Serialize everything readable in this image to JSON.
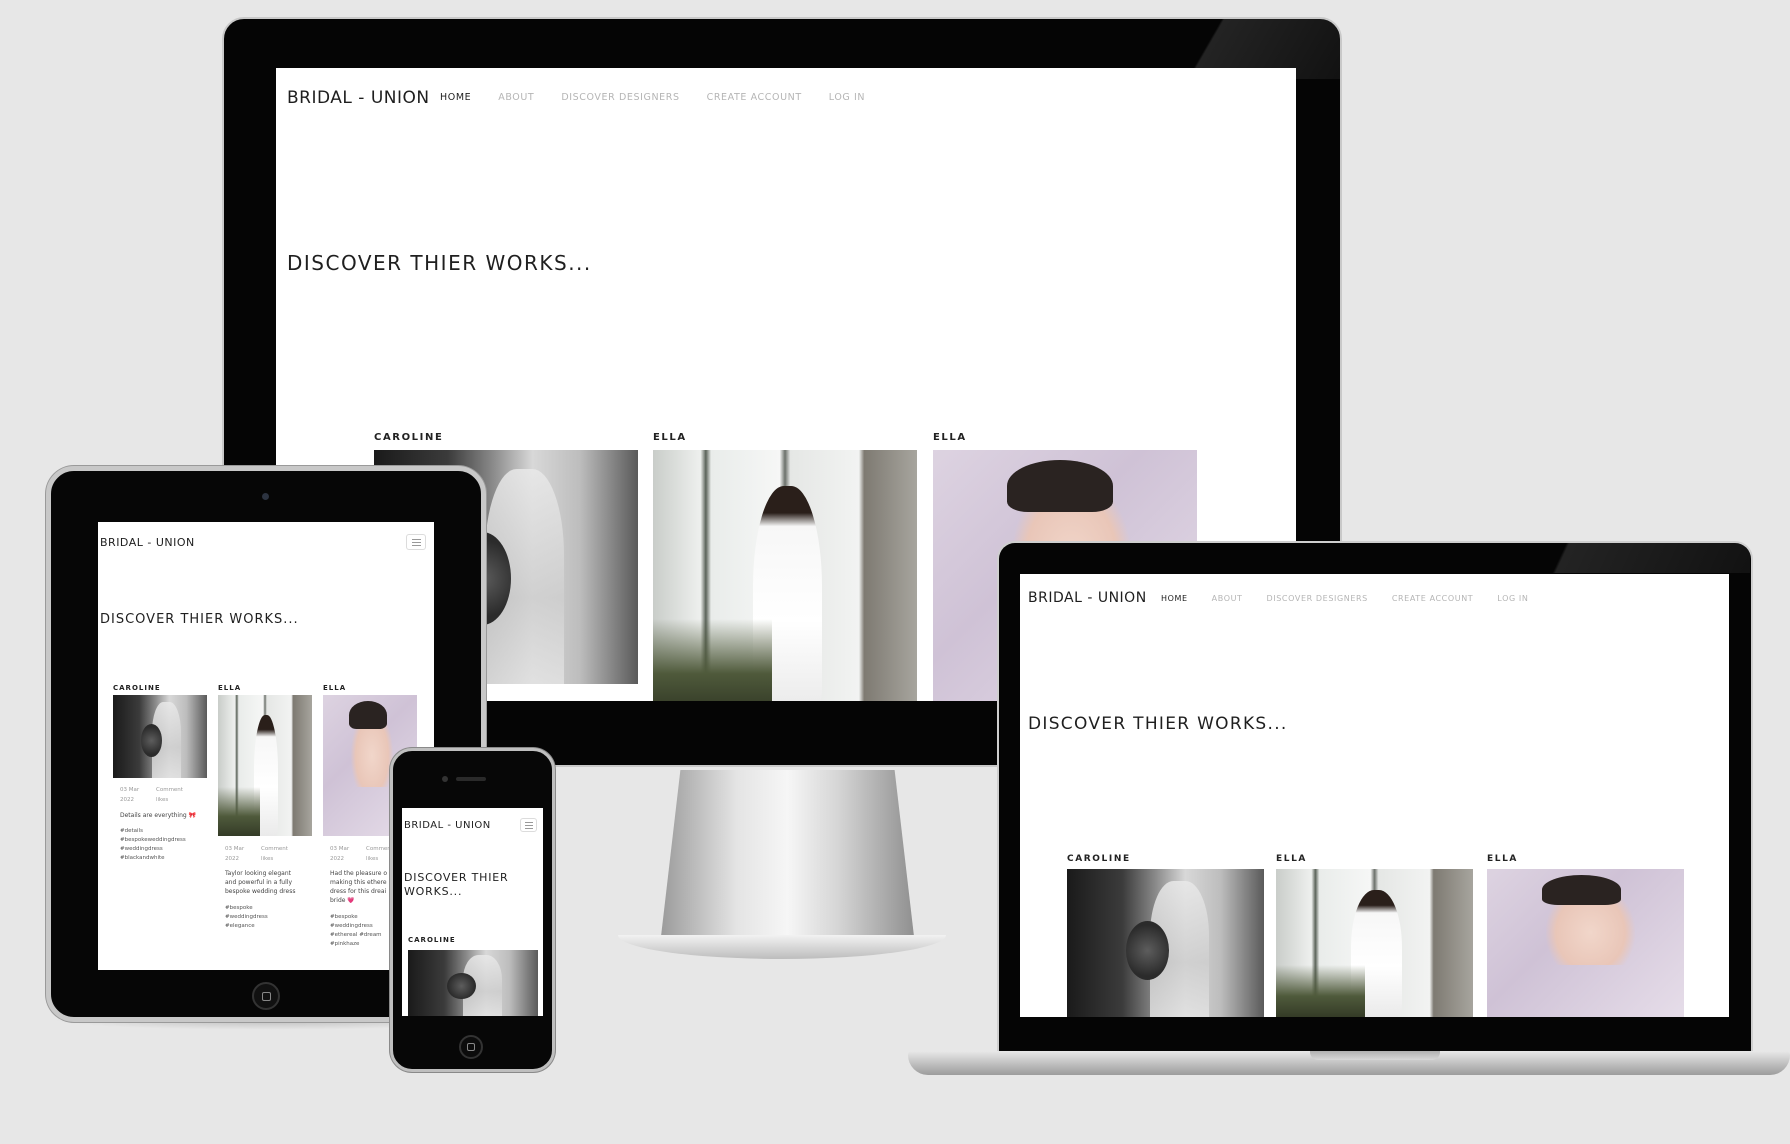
{
  "site": {
    "brand": "BRIDAL - UNION",
    "nav": [
      "HOME",
      "ABOUT",
      "DISCOVER DESIGNERS",
      "CREATE ACCOUNT",
      "LOG IN"
    ],
    "heading": "DISCOVER THIER WORKS...",
    "heading_phone_line1": "DISCOVER THIER",
    "heading_phone_line2": "WORKS...",
    "designers": [
      "CAROLINE",
      "ELLA",
      "ELLA"
    ]
  },
  "posts": [
    {
      "date": "03 Mar\n2022",
      "stats": "Comment\nlikes",
      "caption": "Details are everything 🎀",
      "tags": "#details\n#bespokeweddingdress\n#weddingdress\n#blackandwhite"
    },
    {
      "date": "03 Mar\n2022",
      "stats": "Comment\nlikes",
      "caption": "Taylor looking elegant\nand powerful in a fully\nbespoke wedding dress",
      "tags": "#bespoke\n#weddingdress\n#elegance"
    },
    {
      "date": "03 Mar\n2022",
      "stats": "Comment\nlikes",
      "caption": "Had the pleasure o\nmaking this ethere\ndress for this dreai\nbride 💗",
      "tags": "#bespoke\n#weddingdress\n#ethereal #dream\n#pinkhaze"
    }
  ],
  "colors": {
    "background": "#e7e7e7",
    "bezel": "#000000",
    "nav_inactive": "#b5b5b5",
    "text_dark": "#1e1e1e",
    "photo_pink": "#d7cbdc"
  },
  "icons": {
    "menu": "hamburger-icon",
    "camera": "camera-icon",
    "home_button": "home-button-icon"
  }
}
